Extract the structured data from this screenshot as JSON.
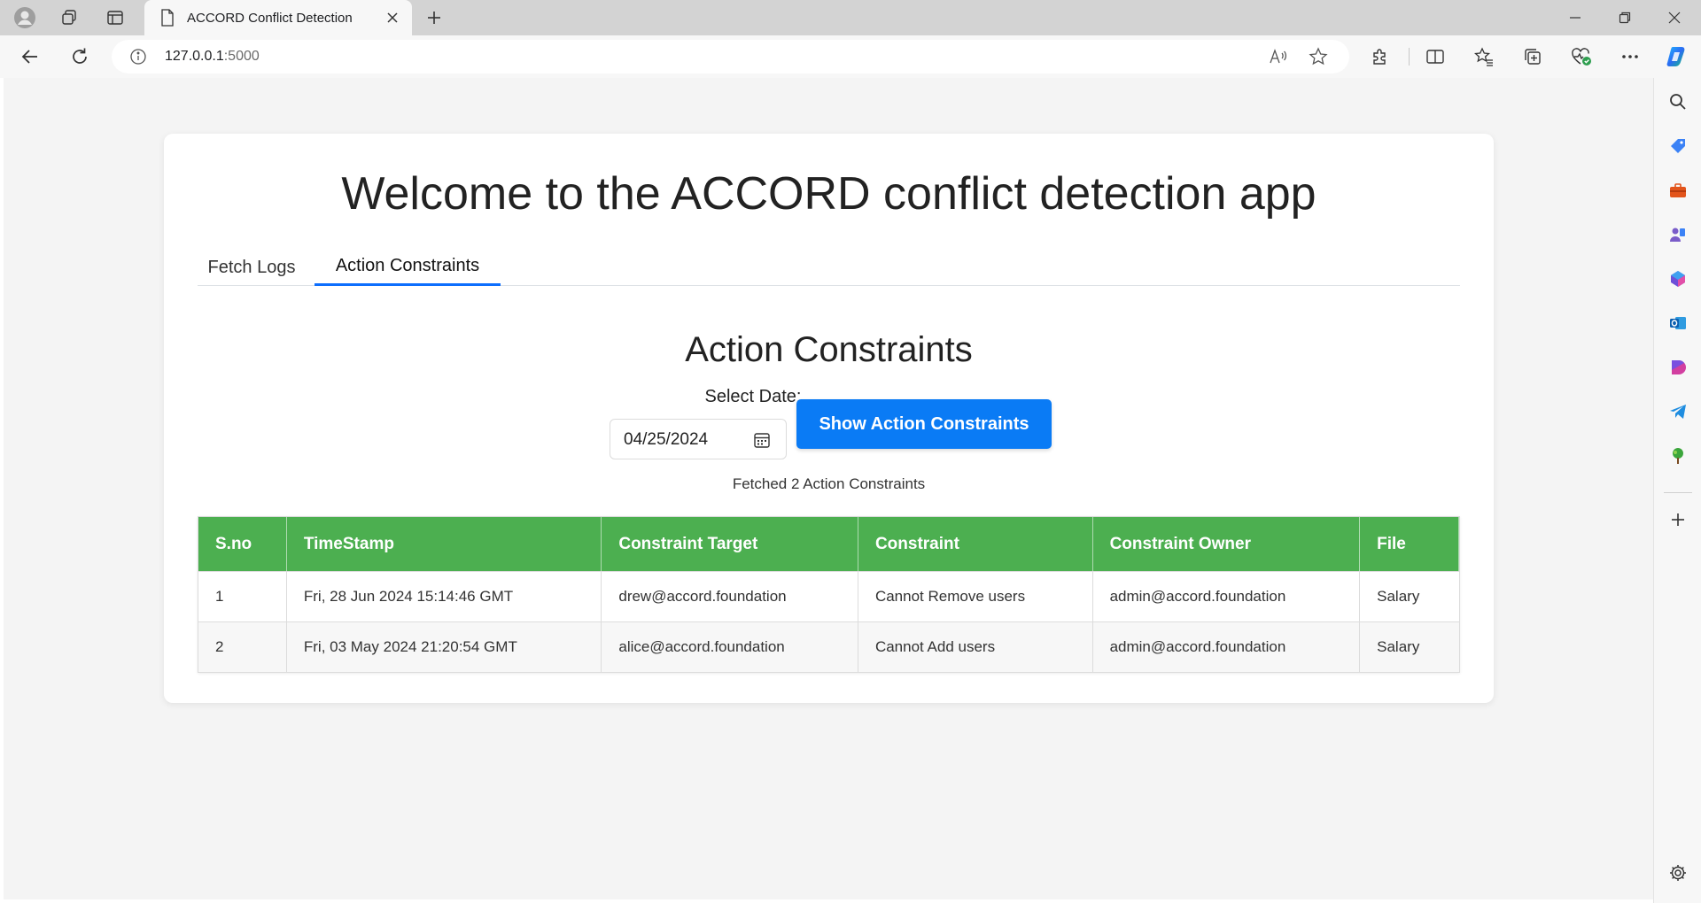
{
  "browser": {
    "tab_title": "ACCORD Conflict Detection",
    "url_host": "127.0.0.1",
    "url_port": ":5000"
  },
  "page": {
    "heading": "Welcome to the ACCORD conflict detection app",
    "tabs": [
      {
        "label": "Fetch Logs",
        "active": false
      },
      {
        "label": "Action Constraints",
        "active": true
      }
    ],
    "section_title": "Action Constraints",
    "date_label": "Select Date:",
    "date_value": "04/25/2024",
    "show_button": "Show Action Constraints",
    "fetched_text": "Fetched 2 Action Constraints",
    "table": {
      "headers": [
        "S.no",
        "TimeStamp",
        "Constraint Target",
        "Constraint",
        "Constraint Owner",
        "File"
      ],
      "rows": [
        [
          "1",
          "Fri, 28 Jun 2024 15:14:46 GMT",
          "drew@accord.foundation",
          "Cannot Remove users",
          "admin@accord.foundation",
          "Salary"
        ],
        [
          "2",
          "Fri, 03 May 2024 21:20:54 GMT",
          "alice@accord.foundation",
          "Cannot Add users",
          "admin@accord.foundation",
          "Salary"
        ]
      ]
    }
  },
  "colors": {
    "primary_button": "#0a7bf5",
    "table_header": "#4caf50",
    "active_tab_underline": "#0d6efd"
  },
  "icons": {
    "titlebar": [
      "profile-icon",
      "workspaces-icon",
      "vertical-tabs-icon",
      "page-icon",
      "close-icon",
      "plus-icon"
    ],
    "window": [
      "minimize-icon",
      "restore-icon",
      "close-window-icon"
    ],
    "toolbar": [
      "back-icon",
      "refresh-icon",
      "info-icon",
      "read-aloud-icon",
      "favorite-star-icon",
      "extensions-icon",
      "split-screen-icon",
      "favorites-icon",
      "collections-icon",
      "browser-essentials-icon",
      "more-icon",
      "copilot-icon"
    ],
    "sidebar": [
      "search-icon",
      "shopping-icon",
      "tools-icon",
      "games-icon",
      "microsoft-365-icon",
      "outlook-icon",
      "designer-icon",
      "telegram-icon",
      "tree-icon",
      "add-icon",
      "settings-icon"
    ]
  }
}
